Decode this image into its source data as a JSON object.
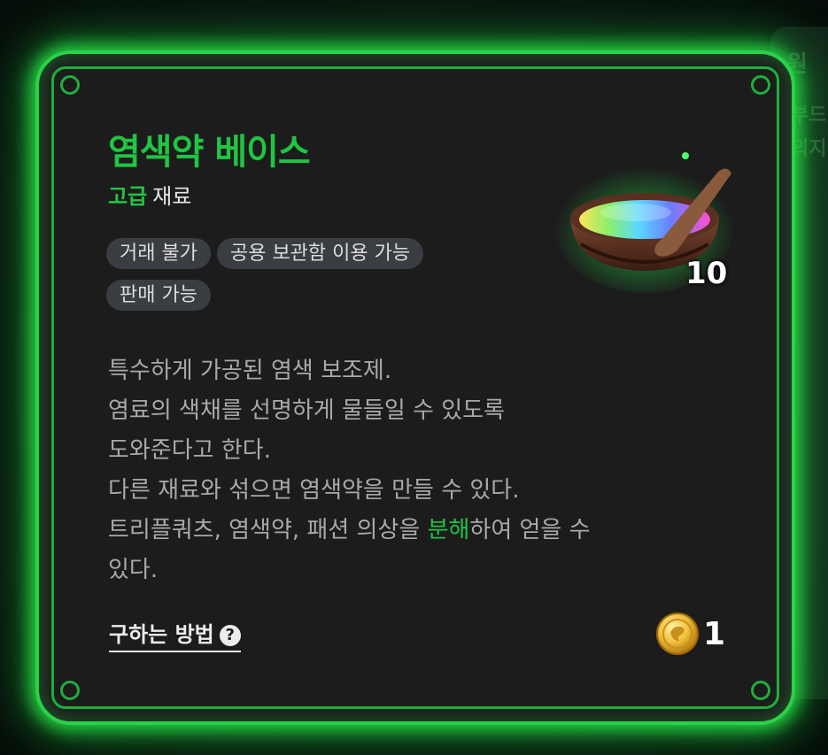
{
  "background": {
    "panel_title": "원",
    "line1": "부드",
    "line2": "의지"
  },
  "item": {
    "name": "염색약 베이스",
    "grade": "고급",
    "category": "재료",
    "quantity": "10",
    "icon": "rainbow-powder-mortar-icon",
    "tags": [
      "거래 불가",
      "공용 보관함 이용 가능",
      "판매 가능"
    ],
    "description": {
      "line1": "특수하게 가공된 염색 보조제.",
      "line2": "염료의 색채를 선명하게 물들일 수 있도록",
      "line3": "도와준다고 한다.",
      "line4": "다른 재료와 섞으면 염색약을 만들 수 있다.",
      "line5_before": "트리플쿼츠, 염색약, 패션 의상을 ",
      "line5_highlight": "분해",
      "line5_after": "하여 얻을 수",
      "line6": "있다."
    },
    "howto_label": "구하는 방법",
    "help_icon": "?",
    "price": "1",
    "price_icon": "gold-coin-icon"
  },
  "colors": {
    "accent": "#22c443",
    "glow": "#2ad24a",
    "card_bg": "#1c1c1c",
    "tag_bg": "#3a3d42",
    "description": "#a9a9a9"
  }
}
